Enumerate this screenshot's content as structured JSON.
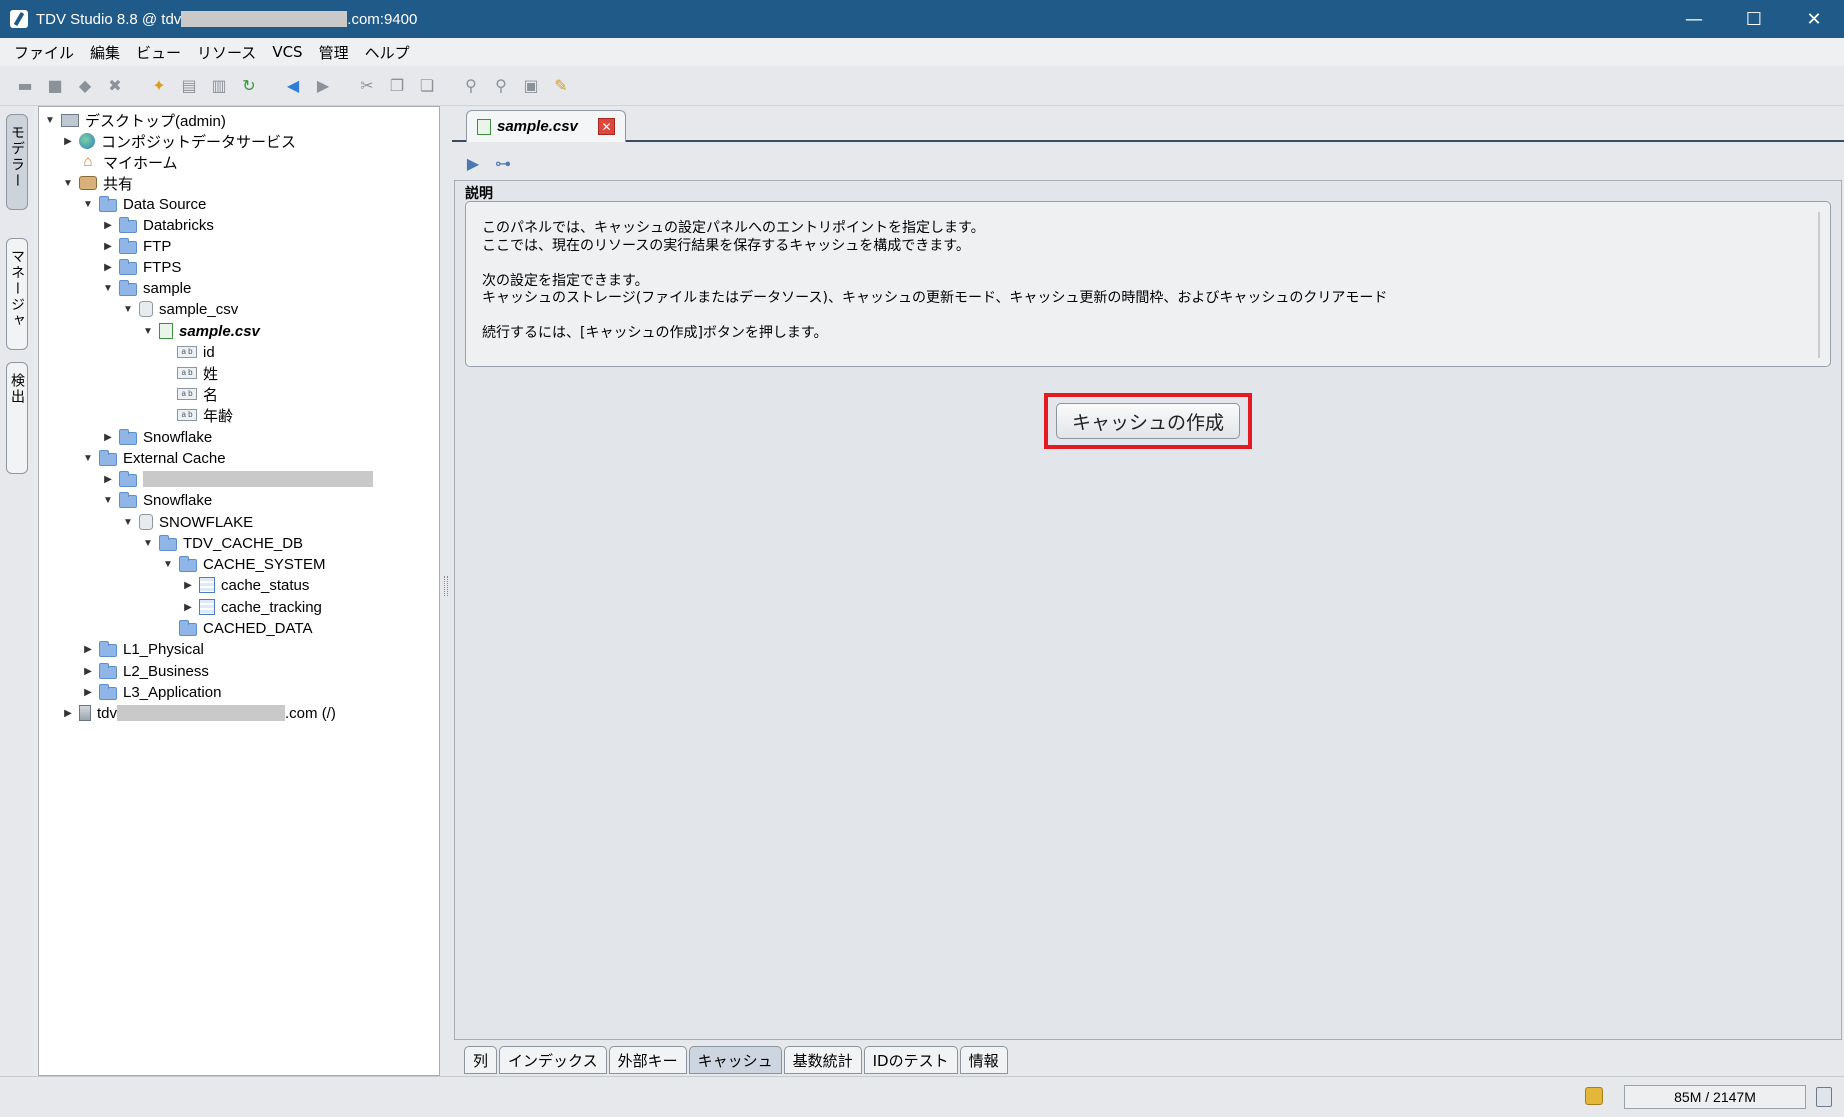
{
  "window": {
    "title_prefix": "TDV Studio 8.8 @ tdv",
    "title_suffix": ".com:9400",
    "minimize": "—",
    "maximize": "☐",
    "close": "✕"
  },
  "menu": [
    "ファイル",
    "編集",
    "ビュー",
    "リソース",
    "VCS",
    "管理",
    "ヘルプ"
  ],
  "side_tabs": [
    "モデラー",
    "マネージャ",
    "検出"
  ],
  "tree": {
    "desktop": "デスクトップ(admin)",
    "composite": "コンポジットデータサービス",
    "myhome": "マイホーム",
    "shared": "共有",
    "datasource": "Data Source",
    "databricks": "Databricks",
    "ftp": "FTP",
    "ftps": "FTPS",
    "sample": "sample",
    "sample_csv": "sample_csv",
    "sample_file": "sample.csv",
    "col_id": "id",
    "col_sei": "姓",
    "col_mei": "名",
    "col_age": "年齢",
    "snowflake_ds": "Snowflake",
    "external_cache": "External Cache",
    "snowflake_ec": "Snowflake",
    "snowflake_db": "SNOWFLAKE",
    "tdv_cache_db": "TDV_CACHE_DB",
    "cache_system": "CACHE_SYSTEM",
    "cache_status": "cache_status",
    "cache_tracking": "cache_tracking",
    "cached_data": "CACHED_DATA",
    "l1": "L1_Physical",
    "l2": "L2_Business",
    "l3": "L3_Application",
    "server_prefix": "tdv",
    "server_suffix": ".com (/)"
  },
  "editor": {
    "tab_title": "sample.csv",
    "section_label": "説明",
    "description": [
      "このパネルでは、キャッシュの設定パネルへのエントリポイントを指定します。",
      "ここでは、現在のリソースの実行結果を保存するキャッシュを構成できます。",
      "",
      "次の設定を指定できます。",
      "キャッシュのストレージ(ファイルまたはデータソース)、キャッシュの更新モード、キャッシュ更新の時間枠、およびキャッシュのクリアモード",
      "",
      "続行するには、[キャッシュの作成]ボタンを押します。"
    ],
    "create_cache_button": "キャッシュの作成",
    "bottom_tabs": [
      "列",
      "インデックス",
      "外部キー",
      "キャッシュ",
      "基数統計",
      "IDのテスト",
      "情報"
    ],
    "active_bottom_tab": "キャッシュ"
  },
  "status": {
    "memory": "85M / 2147M"
  },
  "colors": {
    "titlebar": "#1f5a88",
    "highlight": "#e21b23"
  }
}
